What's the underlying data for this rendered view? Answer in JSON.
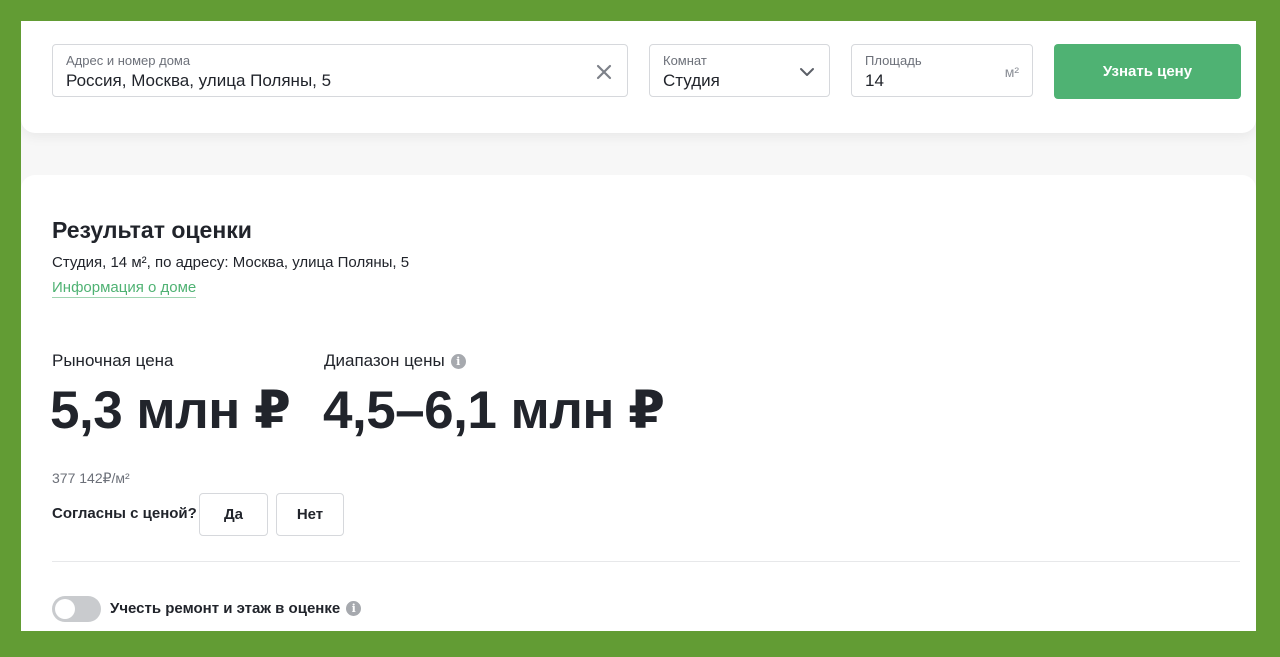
{
  "search": {
    "address": {
      "label": "Адрес и номер дома",
      "value": "Россия, Москва, улица Поляны, 5",
      "clear_icon": "close-icon"
    },
    "rooms": {
      "label": "Комнат",
      "value": "Студия",
      "icon": "chevron-down-icon"
    },
    "area": {
      "label": "Площадь",
      "value": "14",
      "unit": "м²"
    },
    "submit_label": "Узнать цену"
  },
  "result": {
    "title": "Результат оценки",
    "subtitle": "Студия, 14 м², по адресу: Москва, улица Поляны, 5",
    "house_info_link": "Информация о доме",
    "market_price": {
      "label": "Рыночная цена",
      "value": "5,3 млн ₽",
      "per_meter": "377 142₽/м²"
    },
    "price_range": {
      "label": "Диапазон цены",
      "value": "4,5–6,1 млн ₽"
    },
    "feedback": {
      "question": "Согласны с ценой?",
      "yes_label": "Да",
      "no_label": "Нет"
    },
    "toggle": {
      "label": "Учесть ремонт и этаж в оценке",
      "enabled": false
    }
  },
  "colors": {
    "accent": "#4fb273",
    "background_frame": "#629c34",
    "text": "#21242b"
  }
}
